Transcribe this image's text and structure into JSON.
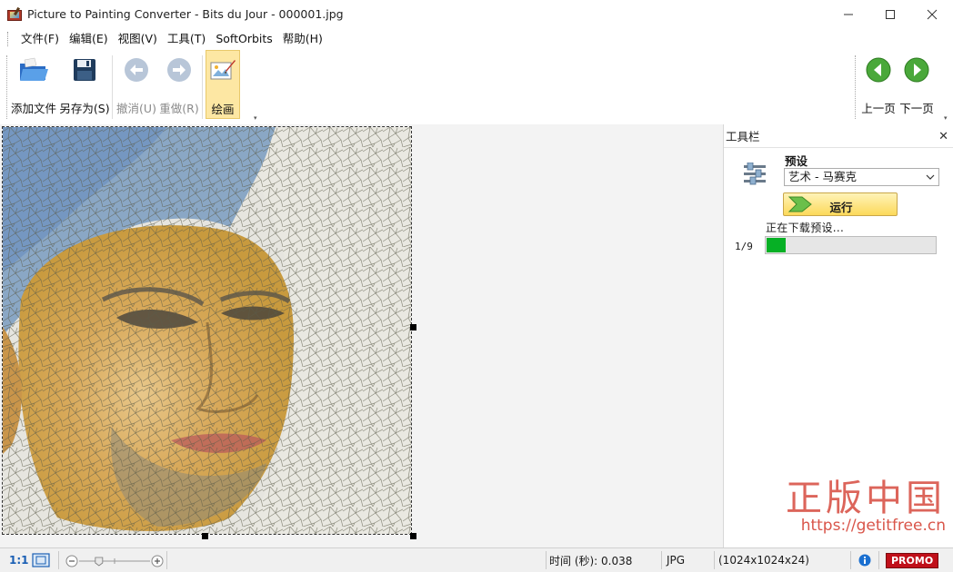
{
  "window": {
    "title": "Picture to Painting Converter - Bits du Jour - 000001.jpg"
  },
  "menu": {
    "items": [
      "文件(F)",
      "编辑(E)",
      "视图(V)",
      "工具(T)",
      "SoftOrbits",
      "帮助(H)"
    ]
  },
  "toolbar": {
    "add_file": "添加文件",
    "save_as": "另存为(S)",
    "undo": "撤消(U)",
    "redo": "重做(R)",
    "paint": "绘画",
    "prev_page": "上一页",
    "next_page": "下一页"
  },
  "panel": {
    "title": "工具栏",
    "preset_label": "预设",
    "preset_value": "艺术 - 马赛克",
    "run_label": "运行",
    "status": "正在下载预设...",
    "progress_count": "1/9",
    "progress_fraction": 0.111
  },
  "statusbar": {
    "ratio": "1:1",
    "time_label": "时间 (秒): 0.038",
    "format": "JPG",
    "dimensions": "(1024x1024x24)",
    "promo": "PROMO",
    "zoom_level": 0.28
  },
  "watermark": {
    "chinese": "正版中国",
    "url": "https://getitfree.cn"
  },
  "colors": {
    "accent_active": "#fde7a3",
    "progress_green": "#06b025",
    "promo_red": "#c0101a",
    "nav_green": "#4aa83a",
    "watermark": "#d9554a"
  }
}
